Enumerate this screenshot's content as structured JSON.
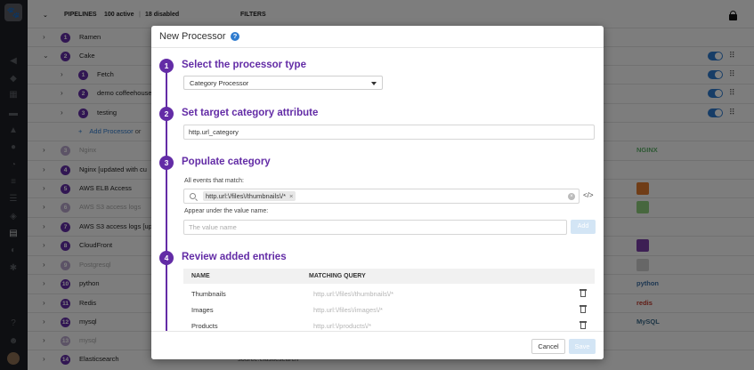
{
  "header": {
    "pipelines_label": "PIPELINES",
    "active_count": "100 active",
    "disabled_count": "18 disabled",
    "filters_label": "FILTERS"
  },
  "rows": [
    {
      "num": "1",
      "name": "Ramen",
      "dim": false
    },
    {
      "num": "2",
      "name": "Cake",
      "dim": false
    },
    {
      "num": "1",
      "name": "Fetch",
      "dim": false
    },
    {
      "num": "2",
      "name": "demo coffeehouse",
      "dim": false
    },
    {
      "num": "3",
      "name": "testing",
      "dim": false
    },
    {
      "num": "3",
      "name": "Nginx",
      "dim": true
    },
    {
      "num": "4",
      "name": "Nginx [updated with cu",
      "dim": false
    },
    {
      "num": "5",
      "name": "AWS ELB Access",
      "dim": false
    },
    {
      "num": "6",
      "name": "AWS S3 access logs",
      "dim": true
    },
    {
      "num": "7",
      "name": "AWS S3 access logs [upd",
      "dim": false
    },
    {
      "num": "8",
      "name": "CloudFront",
      "dim": false
    },
    {
      "num": "9",
      "name": "Postgresql",
      "dim": true
    },
    {
      "num": "10",
      "name": "python",
      "dim": false
    },
    {
      "num": "11",
      "name": "Redis",
      "dim": false
    },
    {
      "num": "12",
      "name": "mysql",
      "dim": false
    },
    {
      "num": "13",
      "name": "mysql",
      "dim": true
    },
    {
      "num": "14",
      "name": "Elasticsearch",
      "dim": false
    }
  ],
  "add_processor_label": "Add Processor",
  "add_processor_suffix": "or",
  "elasticsearch_source": "source:elasticsearch",
  "brands": {
    "nginx": "NGINX",
    "python": "python",
    "redis": "redis",
    "mysql": "MySQL"
  },
  "sidebar_icons": [
    "logo-icon",
    "megaphone-icon",
    "binoculars-icon",
    "dashboard-icon",
    "infrastructure-icon",
    "monitors-icon",
    "apm-icon",
    "notebook-icon",
    "logs-icon",
    "list-icon",
    "pipelines-icon",
    "security-icon",
    "integrations-icon",
    "help-icon",
    "team-icon"
  ],
  "modal": {
    "title": "New Processor",
    "steps": [
      {
        "num": "1",
        "title": "Select the processor type"
      },
      {
        "num": "2",
        "title": "Set target category attribute"
      },
      {
        "num": "3",
        "title": "Populate category"
      },
      {
        "num": "4",
        "title": "Review added entries"
      }
    ],
    "processor_type": "Category Processor",
    "target_attribute": "http.url_category",
    "events_label": "All events that match:",
    "query_chip": "http.url:\\/files\\/thumbnails\\/*",
    "value_label": "Appear under the value name:",
    "value_placeholder": "The value name",
    "add_label": "Add",
    "table": {
      "col_name": "NAME",
      "col_query": "MATCHING QUERY",
      "rows": [
        {
          "name": "Thumbnails",
          "query": "http.url:\\/files\\/thumbnails\\/*"
        },
        {
          "name": "Images",
          "query": "http.url:\\/files\\/images\\/*"
        },
        {
          "name": "Products",
          "query": "http.url:\\/products\\/*"
        }
      ]
    },
    "cancel_label": "Cancel",
    "save_label": "Save"
  },
  "colors": {
    "accent": "#632ca6",
    "link": "#2e7bcf",
    "toggle": "#2e7bcf"
  }
}
